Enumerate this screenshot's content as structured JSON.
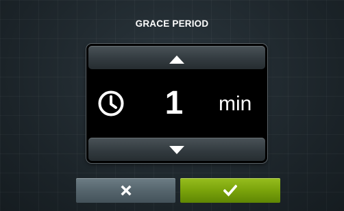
{
  "dialog": {
    "title": "GRACE PERIOD"
  },
  "setting": {
    "value": "1",
    "unit": "min",
    "icon": "clock-icon"
  },
  "controls": {
    "increment_icon": "triangle-up-icon",
    "decrement_icon": "triangle-down-icon",
    "cancel_icon": "x-icon",
    "confirm_icon": "checkmark-icon"
  },
  "colors": {
    "confirm_accent": "#7aa30b",
    "cancel_accent": "#56656d",
    "panel_background": "#000000"
  }
}
